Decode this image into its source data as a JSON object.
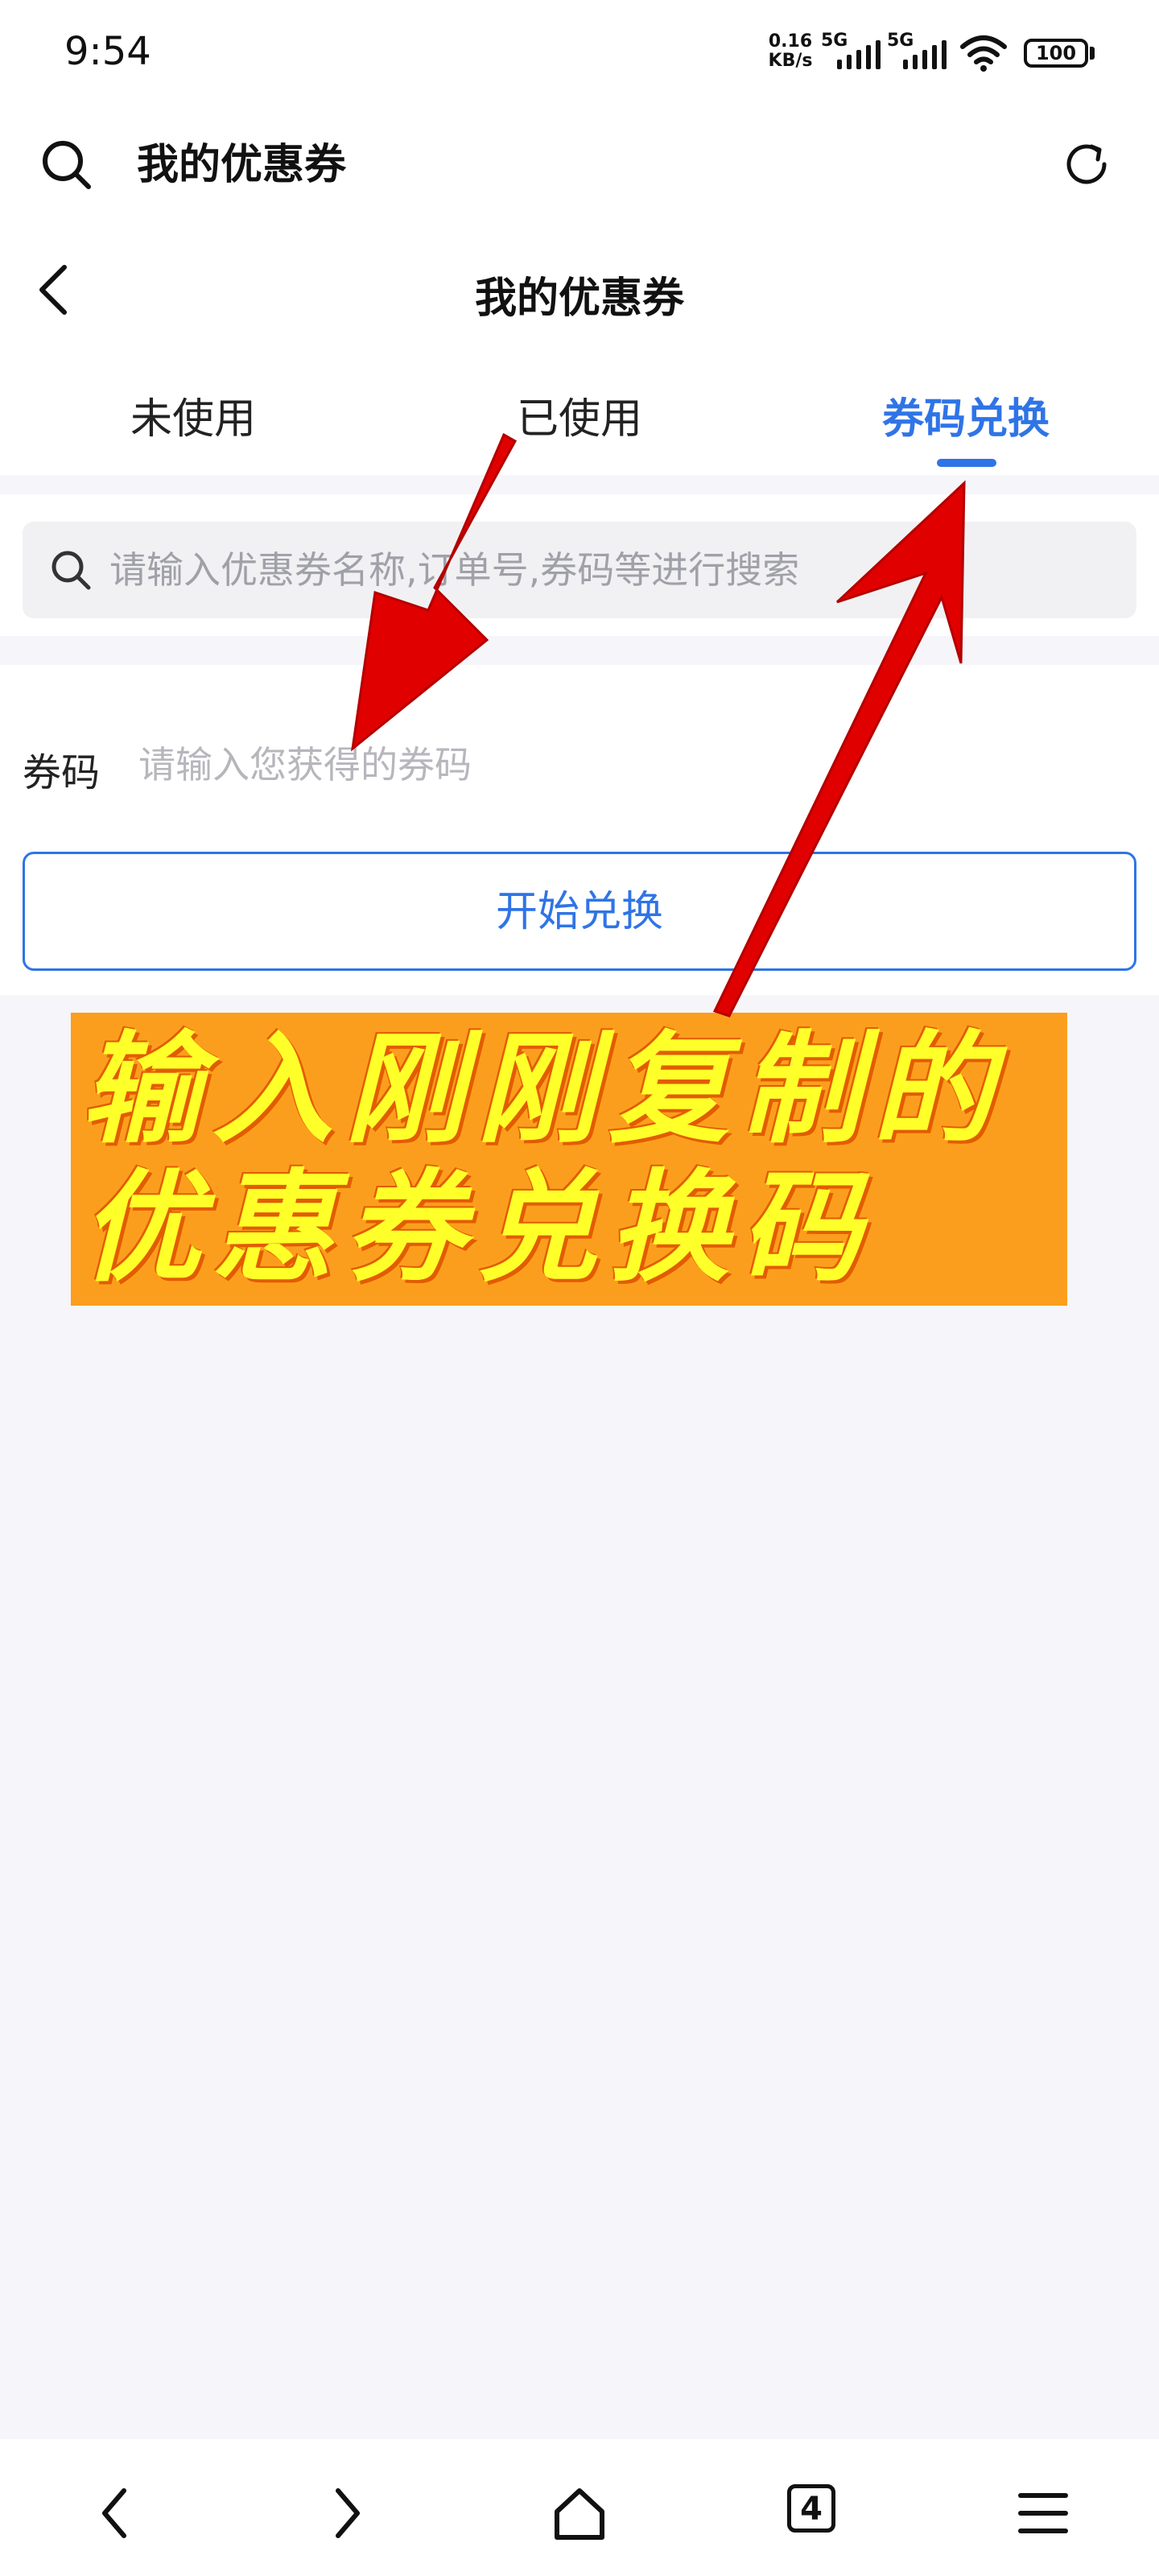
{
  "status_bar": {
    "time": "9:54",
    "network_speed_value": "0.16",
    "network_speed_unit": "KB/s",
    "sim1": "5G",
    "sim2": "5G",
    "battery": "100"
  },
  "browser": {
    "title": "我的优惠券",
    "search_icon": "search-icon",
    "refresh_icon": "refresh-icon"
  },
  "page": {
    "title": "我的优惠券",
    "back_icon": "chevron-left-icon"
  },
  "tabs": [
    {
      "label": "未使用",
      "active": false
    },
    {
      "label": "已使用",
      "active": false
    },
    {
      "label": "券码兑换",
      "active": true
    }
  ],
  "search": {
    "placeholder": "请输入优惠券名称,订单号,券码等进行搜索"
  },
  "redeem_form": {
    "label": "券码",
    "placeholder": "请输入您获得的券码",
    "button_label": "开始兑换"
  },
  "annotation": {
    "line1": "输入刚刚复制的",
    "line2": "优惠券兑换码",
    "arrow_color": "#e00000",
    "banner_color": "#fc9e1d",
    "text_color": "#ffff2a"
  },
  "bottom_nav": {
    "items": [
      "back-icon",
      "forward-icon",
      "home-icon",
      "tabs-icon",
      "menu-icon"
    ],
    "tab_count": "4"
  },
  "colors": {
    "accent": "#2f74e6",
    "background": "#f5f5fa"
  }
}
